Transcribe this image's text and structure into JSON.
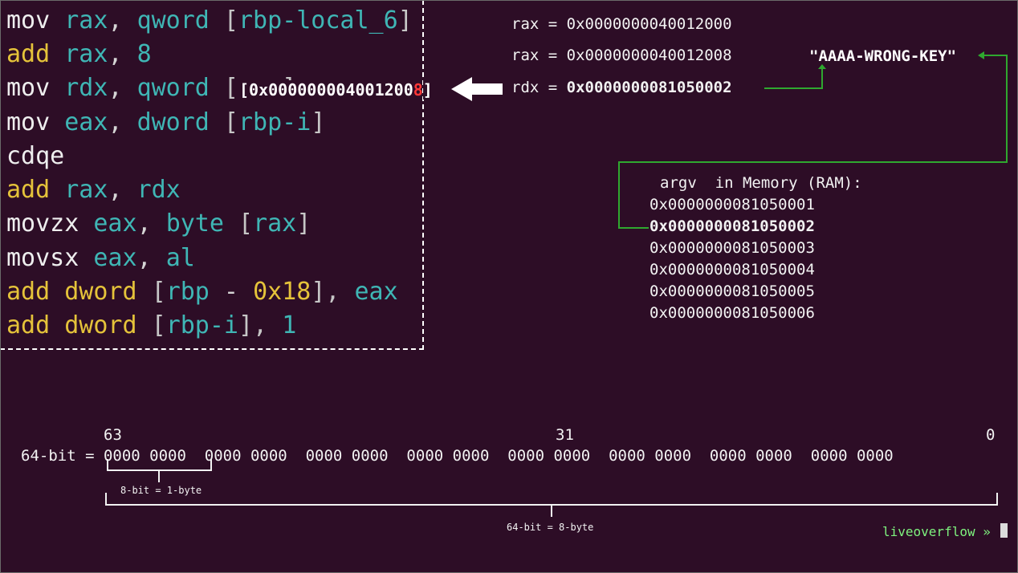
{
  "assembly": {
    "lines": [
      {
        "op": "mov",
        "operands": [
          {
            "t": "rax",
            "c": "reg"
          },
          {
            "t": ", ",
            "c": "punc"
          },
          {
            "t": "qword",
            "c": "reg"
          },
          {
            "t": " [",
            "c": "br"
          },
          {
            "t": "rbp-local_6",
            "c": "reg"
          },
          {
            "t": "]",
            "c": "br"
          }
        ]
      },
      {
        "op": "add",
        "operands": [
          {
            "t": "rax",
            "c": "reg"
          },
          {
            "t": ", ",
            "c": "punc"
          },
          {
            "t": "8",
            "c": "num"
          }
        ]
      },
      {
        "op": "mov",
        "operands": [
          {
            "t": "rdx",
            "c": "reg"
          },
          {
            "t": ", ",
            "c": "punc"
          },
          {
            "t": "qword",
            "c": "reg"
          },
          {
            "t": " [",
            "c": "br"
          },
          {
            "t": "rax",
            "c": "reg"
          },
          {
            "t": "]",
            "c": "br"
          }
        ]
      },
      {
        "op": "mov",
        "operands": [
          {
            "t": "eax",
            "c": "reg"
          },
          {
            "t": ", ",
            "c": "punc"
          },
          {
            "t": "dword",
            "c": "reg"
          },
          {
            "t": " [",
            "c": "br"
          },
          {
            "t": "rbp-i",
            "c": "reg"
          },
          {
            "t": "]",
            "c": "br"
          }
        ]
      },
      {
        "op": "cdqe",
        "operands": []
      },
      {
        "op": "add",
        "operands": [
          {
            "t": "rax",
            "c": "reg"
          },
          {
            "t": ", ",
            "c": "punc"
          },
          {
            "t": "rdx",
            "c": "reg"
          }
        ]
      },
      {
        "op": "movzx",
        "operands": [
          {
            "t": "eax",
            "c": "reg"
          },
          {
            "t": ", ",
            "c": "punc"
          },
          {
            "t": "byte",
            "c": "reg"
          },
          {
            "t": " [",
            "c": "br"
          },
          {
            "t": "rax",
            "c": "reg"
          },
          {
            "t": "]",
            "c": "br"
          }
        ]
      },
      {
        "op": "movsx",
        "operands": [
          {
            "t": "eax",
            "c": "reg"
          },
          {
            "t": ", ",
            "c": "punc"
          },
          {
            "t": "al",
            "c": "reg"
          }
        ]
      },
      {
        "op": "add",
        "operands": [
          {
            "t": "dword",
            "c": "op"
          },
          {
            "t": " [",
            "c": "br"
          },
          {
            "t": "rbp",
            "c": "reg"
          },
          {
            "t": " - ",
            "c": "punc"
          },
          {
            "t": "0x18",
            "c": "op"
          },
          {
            "t": "], ",
            "c": "br"
          },
          {
            "t": "eax",
            "c": "reg"
          }
        ]
      },
      {
        "op": "add",
        "operands": [
          {
            "t": "dword",
            "c": "op"
          },
          {
            "t": " [",
            "c": "br"
          },
          {
            "t": "rbp-i",
            "c": "reg"
          },
          {
            "t": "], ",
            "c": "br"
          },
          {
            "t": "1",
            "c": "num"
          }
        ]
      }
    ],
    "overlay_value_prefix": "[0x00000000400120",
    "overlay_value_mid": "0",
    "overlay_value_red": "8",
    "overlay_value_suffix": "]"
  },
  "registers": {
    "line1": "rax = 0x0000000040012000",
    "line2": "rax = 0x0000000040012008",
    "line3": "rdx = 0x0000000081050002"
  },
  "string_value": "\"AAAA-WRONG-KEY\"",
  "argv": {
    "title": "argv  in Memory (RAM):",
    "items": [
      "0x0000000081050001",
      "0x0000000081050002",
      "0x0000000081050003",
      "0x0000000081050004",
      "0x0000000081050005",
      "0x0000000081050006"
    ],
    "highlighted_index": 1
  },
  "bits": {
    "label_63": "63",
    "label_31": "31",
    "label_0": "0",
    "row": "64-bit = 0000 0000  0000 0000  0000 0000  0000 0000  0000 0000  0000 0000  0000 0000  0000 0000",
    "byte_label": "8-bit = 1-byte",
    "qword_label": "64-bit = 8-byte"
  },
  "terminal": {
    "prompt": "liveoverflow »"
  },
  "colors": {
    "background": "#2d0d26",
    "mnemonic_yellow": "#e5c33a",
    "register_teal": "#3fb6b5",
    "pointer_green": "#2fa82f",
    "highlight_red": "#ff3838",
    "prompt_green": "#7ef27e"
  }
}
